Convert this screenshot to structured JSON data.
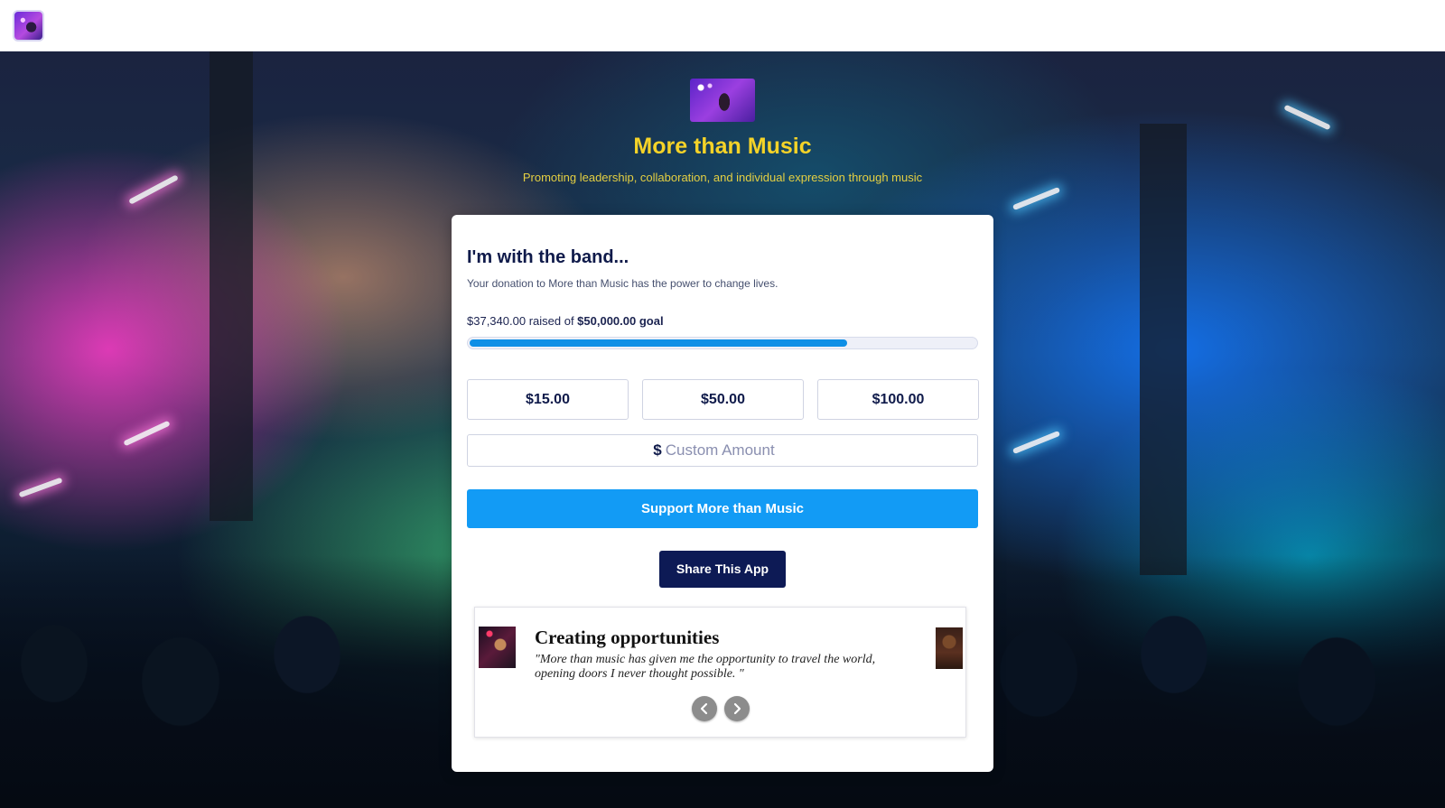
{
  "app": {
    "icon": "app-logo-icon"
  },
  "hero": {
    "title": "More than Music",
    "tagline": "Promoting leadership, collaboration, and individual expression through music",
    "title_color": "#f5d328"
  },
  "card": {
    "heading": "I'm with the band...",
    "subheading": "Your donation to More than Music has the power to change lives.",
    "raised_amount": "$37,340.00",
    "raised_text": " raised of ",
    "goal_amount": "$50,000.00 goal",
    "progress_fraction": 0.7468,
    "amounts": [
      "$15.00",
      "$50.00",
      "$100.00"
    ],
    "currency_symbol": "$",
    "custom_placeholder": "Custom Amount",
    "support_label": "Support More than Music",
    "share_label": "Share This App"
  },
  "testimonial": {
    "title": "Creating opportunities",
    "quote": "\"More than music has given me the opportunity to travel the world, opening doors I never thought possible. \"",
    "prev_icon": "chevron-left-icon",
    "next_icon": "chevron-right-icon"
  },
  "colors": {
    "accent_blue": "#129bf5",
    "navy": "#0d1a55",
    "progress": "#0e8fe6"
  }
}
